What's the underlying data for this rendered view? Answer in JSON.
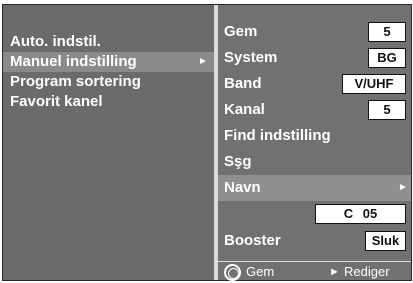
{
  "left_menu": {
    "items": [
      {
        "label": "Auto. indstil."
      },
      {
        "label": "Manuel indstilling"
      },
      {
        "label": "Program sortering"
      },
      {
        "label": "Favorit kanel"
      }
    ],
    "arrow": "►"
  },
  "right_menu": {
    "gem": {
      "label": "Gem",
      "value": "5"
    },
    "system": {
      "label": "System",
      "value": "BG"
    },
    "band": {
      "label": "Band",
      "value": "V/UHF"
    },
    "kanal": {
      "label": "Kanal",
      "value": "5"
    },
    "find": {
      "label": "Find indstilling"
    },
    "sog": {
      "label": "Sşg"
    },
    "navn": {
      "label": "Navn",
      "arrow": "►"
    },
    "name_value": "C   05",
    "booster": {
      "label": "Booster",
      "value": "Sluk"
    }
  },
  "footer": {
    "ok_label": "Gem",
    "edit_arrow": "►",
    "edit_label": "Rediger"
  },
  "colors": {
    "background": "#6d6d6d",
    "selected": "#8a8a8a",
    "text": "#ffffff",
    "divider": "#dcdcdc"
  }
}
